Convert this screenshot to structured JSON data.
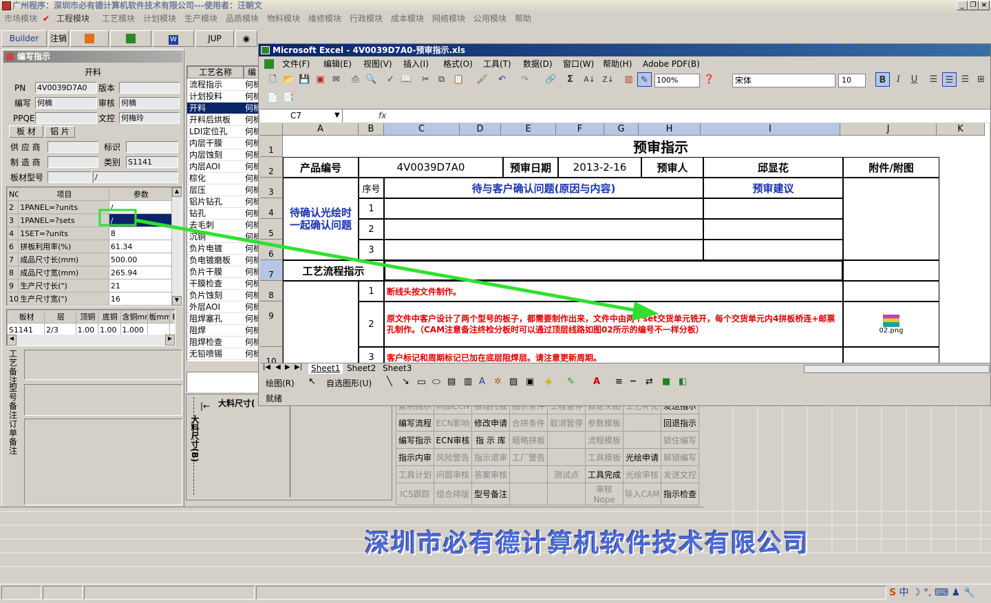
{
  "app": {
    "title": "广州程序：深圳市必有德计算机软件技术有限公司---使用者：汪朝文"
  },
  "menu": [
    "市场模块",
    "工程模块",
    "工艺模块",
    "计划模块",
    "生产模块",
    "品质模块",
    "物料模块",
    "维修模块",
    "行政模块",
    "成本模块",
    "网络模块",
    "公用模块",
    "帮助"
  ],
  "menu_checked_index": 1,
  "toolbar": {
    "builder": "Builder",
    "logout": "注销",
    "jup": "JUP"
  },
  "left": {
    "window_title": "编写指示",
    "section_title": "开料",
    "pn_label": "PN",
    "pn_value": "4V0039D7A0",
    "version_label": "版本",
    "version_value": "",
    "writer_label": "编写",
    "writer_value": "何楠",
    "review_label": "审核",
    "review_value": "何楠",
    "ppqe_label": "PPQE",
    "ppqe_value": "",
    "doc_label": "文控",
    "doc_value": "何梅玲",
    "tab_board": "板 材",
    "tab_alu": "铝 片",
    "supplier_label": "供 应 商",
    "mark_label": "标识",
    "maker_label": "制 造 商",
    "type_label": "类别",
    "type_value": "S1141",
    "board_model_label": "板材型号",
    "board_model_value": "/",
    "param_headers": [
      "NO",
      "项目",
      "参数"
    ],
    "params": [
      {
        "no": "2",
        "item": "1PANEL=?units",
        "val": "/"
      },
      {
        "no": "3",
        "item": "1PANEL=?sets",
        "val": "/"
      },
      {
        "no": "4",
        "item": "1SET=?units",
        "val": "8"
      },
      {
        "no": "6",
        "item": "拼板利用率(%)",
        "val": "61.34"
      },
      {
        "no": "7",
        "item": "成品尺寸长(mm)",
        "val": "500.00"
      },
      {
        "no": "8",
        "item": "成品尺寸宽(mm)",
        "val": "265.94"
      },
      {
        "no": "9",
        "item": "生产尺寸长(\")",
        "val": "21"
      },
      {
        "no": "10",
        "item": "生产尺寸宽(\")",
        "val": "16"
      }
    ],
    "mat_headers": [
      "板材",
      "层",
      "顶铜",
      "底铜",
      "含铜mm",
      "板mm",
      "E"
    ],
    "mat_row": [
      "S1141",
      "2/3",
      "1.00",
      "1.00",
      "1.000",
      "",
      ""
    ],
    "note_labels": [
      "工艺备注",
      "型号备注",
      "订单备注"
    ]
  },
  "process": {
    "headers": [
      "工艺名称",
      "编"
    ],
    "items": [
      "流程指示",
      "计划投料",
      "开料",
      "开料后烘板",
      "LDI定位孔",
      "内层干膜",
      "内层蚀刻",
      "内层AOI",
      "棕化",
      "层压",
      "铝片钻孔",
      "钻孔",
      "去毛刺",
      "沉铜",
      "负片电镀",
      "负电镀磨板",
      "负片干膜",
      "干膜检查",
      "负片蚀刻",
      "外层AOI",
      "阻焊塞孔",
      "阻焊",
      "阻焊检查",
      "无铅喷锡"
    ],
    "owner": "何楠",
    "selected_index": 2
  },
  "excel": {
    "title": "Microsoft Excel - 4V0039D7A0-预审指示.xls",
    "menu": [
      "文件(F)",
      "编辑(E)",
      "视图(V)",
      "插入(I)",
      "格式(O)",
      "工具(T)",
      "数据(D)",
      "窗口(W)",
      "帮助(H)",
      "Adobe PDF(B)"
    ],
    "zoom": "100%",
    "font": "宋体",
    "font_size": "10",
    "name_box": "C7",
    "fx": "fx",
    "columns": [
      "A",
      "B",
      "C",
      "D",
      "E",
      "F",
      "G",
      "H",
      "I",
      "J",
      "K"
    ],
    "rows": [
      "1",
      "2",
      "3",
      "4",
      "5",
      "6",
      "7",
      "8",
      "9",
      "10"
    ],
    "sheet_title": "预审指示",
    "product_no_label": "产品编号",
    "product_no": "4V0039D7A0",
    "date_label": "预审日期",
    "date": "2013-2-16",
    "reviewer_label": "预审人",
    "reviewer": "邱显花",
    "attach_label": "附件/附图",
    "seq_label": "序号",
    "issue_label": "待与客户确认问题(原因与内容)",
    "suggest_label": "预审建议",
    "pending_label": "待确认光绘时一起确认问题",
    "seq": [
      "1",
      "2",
      "3"
    ],
    "flow_label": "工艺流程指示",
    "flow_rows": [
      {
        "no": "1",
        "text": "断线头按文件制作。"
      },
      {
        "no": "2",
        "text": "原文件中客户设计了两个型号的板子，都需要制作出来，文件中由两个set交货单元铣开，每个交货单元内4拼板桥连+邮票孔制作。（CAM注意备注终检分板时可以通过顶层线路如图02所示的编号不一样分板）"
      },
      {
        "no": "3",
        "text": "客户标记和周期标记已加在底层阻焊层。请注意更新周期。"
      }
    ],
    "attachment": "02.png",
    "sheets": [
      "Sheet1",
      "Sheet2",
      "Sheet3"
    ],
    "draw_label": "绘图(R)",
    "autoshape_label": "自选图形(U)",
    "status": "就绪"
  },
  "diagram": {
    "big_len": "大料尺寸(",
    "big_wid": "大料尺寸(B)"
  },
  "bottom_buttons": [
    [
      [
        "复制指示",
        0
      ],
      [
        "同部ECN",
        0
      ],
      [
        "香理托板",
        0
      ],
      [
        "报价条件",
        0
      ],
      [
        "工程暂停",
        0
      ],
      [
        "自定义图",
        0
      ],
      [
        "工艺补充",
        0
      ],
      [
        "发送指示",
        1
      ]
    ],
    [
      [
        "编写流程",
        1
      ],
      [
        "ECN影响",
        0
      ],
      [
        "修改申请",
        1
      ],
      [
        "合拼条件",
        0
      ],
      [
        "取消暂停",
        0
      ],
      [
        "参数模板",
        0
      ],
      [
        "",
        0
      ],
      [
        "回退指示",
        1
      ]
    ],
    [
      [
        "编写指示",
        1
      ],
      [
        "ECN审核",
        1
      ],
      [
        "指 示 库",
        1
      ],
      [
        "粗略拼板",
        0
      ],
      [
        "",
        0
      ],
      [
        "流程模板",
        0
      ],
      [
        "",
        0
      ],
      [
        "锁住编写",
        0
      ]
    ],
    [
      [
        "指示内审",
        1
      ],
      [
        "风险警告",
        0
      ],
      [
        "指示退审",
        0
      ],
      [
        "工厂警告",
        0
      ],
      [
        "",
        0
      ],
      [
        "工具模板",
        0
      ],
      [
        "光绘申请",
        1
      ],
      [
        "解锁编写",
        0
      ]
    ],
    [
      [
        "工具计划",
        0
      ],
      [
        "问题审核",
        0
      ],
      [
        "答案审核",
        0
      ],
      [
        "",
        0
      ],
      [
        "测试点",
        0
      ],
      [
        "工具完成",
        1
      ],
      [
        "光绘审核",
        0
      ],
      [
        "发送文控",
        0
      ]
    ],
    [
      [
        "ICS跟踪",
        0
      ],
      [
        "组合排版",
        0
      ],
      [
        "型号备注",
        1
      ],
      [
        "",
        0
      ],
      [
        "",
        0
      ],
      [
        "审核Nope",
        0
      ],
      [
        "导入CAM",
        0
      ],
      [
        "指示检查",
        1
      ]
    ]
  ],
  "company": "深圳市必有德计算机软件技术有限公司",
  "tray": {
    "ime": "中"
  }
}
